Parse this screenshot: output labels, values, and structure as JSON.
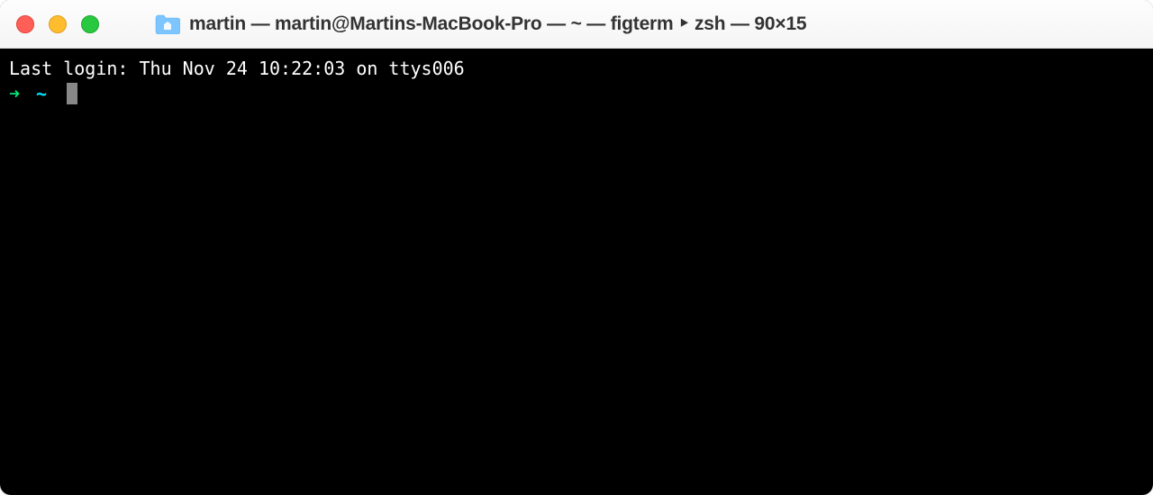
{
  "titlebar": {
    "window_title": "martin — martin@Martins-MacBook-Pro — ~ — figterm ‣ zsh — 90×15",
    "icon": "home-folder-icon"
  },
  "terminal": {
    "last_login": "Last login: Thu Nov 24 10:22:03 on ttys006",
    "prompt_arrow": "➜",
    "prompt_cwd": "~"
  },
  "colors": {
    "close": "#ff5f57",
    "minimize": "#febc2e",
    "maximize": "#28c840",
    "prompt_arrow": "#00e676",
    "prompt_cwd": "#00e5ff",
    "terminal_bg": "#000000",
    "terminal_fg": "#ffffff"
  }
}
